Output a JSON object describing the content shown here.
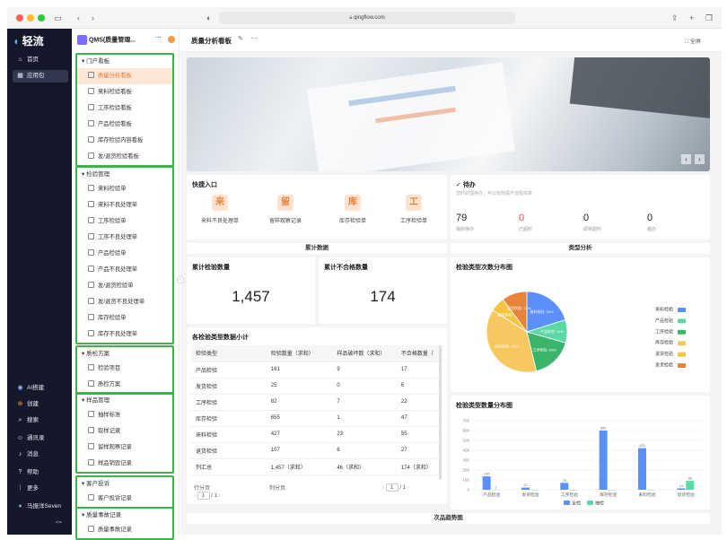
{
  "browser": {
    "url": "qingflow.com"
  },
  "rail": {
    "logo_text": "轻流",
    "items": [
      "首页",
      "应用包"
    ],
    "bottom_items": [
      "AI搭建",
      "创建",
      "搜索",
      "通讯录",
      "消息",
      "帮助",
      "更多"
    ],
    "user": "马振洋Seven",
    "collapse": "<="
  },
  "app": {
    "name": "QMS(质量管理...",
    "more": "···"
  },
  "groups": [
    {
      "name": "门户看板",
      "items": [
        "质量分析看板",
        "来料检验看板",
        "工序检验看板",
        "产品检验看板",
        "库存检验内容看板",
        "发/退货检验看板"
      ]
    },
    {
      "name": "检验管理",
      "items": [
        "来料检验单",
        "来料不良处理单",
        "工序检验单",
        "工序不良处理单",
        "产品检验单",
        "产品不良处理单",
        "发/退货检验单",
        "发/退货不良处理单",
        "库存检验单",
        "库存不良处理单"
      ]
    },
    {
      "name": "质检方案",
      "items": [
        "检验项目",
        "质检方案"
      ]
    },
    {
      "name": "样品管理",
      "items": [
        "抽样标准",
        "取样记录",
        "留样观察记录",
        "样品销毁记录"
      ]
    },
    {
      "name": "客户投诉",
      "items": [
        "客户投诉记录"
      ]
    },
    {
      "name": "质量事故记录",
      "items": [
        "质量事故记录"
      ]
    }
  ],
  "header": {
    "title": "质量分析看板",
    "fullscreen": "全屏"
  },
  "quick": {
    "title": "快捷入口",
    "items": [
      {
        "glyph": "来",
        "label": "来料不良处理单"
      },
      {
        "glyph": "留",
        "label": "留样观察记录"
      },
      {
        "glyph": "库",
        "label": "库存检验单"
      },
      {
        "glyph": "工",
        "label": "工序检验单"
      }
    ]
  },
  "todo": {
    "title": "待办",
    "subtitle": "您时处理待办，可以有效提升流程效率",
    "stats": [
      {
        "value": "79",
        "label": "我的待办"
      },
      {
        "value": "0",
        "label": "已超时"
      },
      {
        "value": "0",
        "label": "即将超时"
      },
      {
        "value": "0",
        "label": "催办"
      }
    ]
  },
  "sections": {
    "cumulative": "累计数据",
    "type_analysis": "类型分析",
    "trend": "次品趋势图"
  },
  "kpi": [
    {
      "label": "累计检验数量",
      "value": "1,457"
    },
    {
      "label": "累计不合格数量",
      "value": "174"
    }
  ],
  "table": {
    "title": "各检验类型数据小计",
    "columns": [
      "检验类型",
      "检验数量（求和）",
      "样品破坏数（求和）",
      "不合格数量（"
    ],
    "rows": [
      [
        "产品检验",
        "161",
        "9",
        "17"
      ],
      [
        "发货检验",
        "25",
        "0",
        "6"
      ],
      [
        "工序检验",
        "82",
        "7",
        "22"
      ],
      [
        "库存检验",
        "655",
        "1",
        "47"
      ],
      [
        "来料检验",
        "427",
        "23",
        "55"
      ],
      [
        "退货检验",
        "107",
        "6",
        "27"
      ]
    ],
    "summary": [
      "列汇总",
      "1,457（求和）",
      "46（求和）",
      "174（求和）"
    ],
    "pager_left": "行分页",
    "pager_right": "列分页",
    "page": "1",
    "total": "/ 1"
  },
  "pie": {
    "title": "检验类型次数分布图",
    "colors": [
      "#5b8ff9",
      "#5ad8a6",
      "#3bb56b",
      "#f6c85f",
      "#f4c542",
      "#e8833a"
    ],
    "legend": [
      "来料检验",
      "产品检验",
      "工序检验",
      "库存检验",
      "退货检验",
      "发货检验"
    ],
    "slice_labels": [
      "来料检验: 24%",
      "产品检验: 11%",
      "工序检验: 20%",
      "库存检验: 45%",
      "退货检验: 7%",
      "发货检验: 12%"
    ]
  },
  "chart_data": {
    "type": "bar",
    "title": "检验类型数量分布图",
    "categories": [
      "产品检验",
      "发货检验",
      "工序检验",
      "库存检验",
      "来料检验",
      "退货检验"
    ],
    "series": [
      {
        "name": "全检",
        "values": [
          136,
          22,
          70,
          600,
          422,
          14
        ]
      },
      {
        "name": "抽检",
        "values": [
          1,
          0,
          0,
          0,
          0,
          90
        ]
      }
    ],
    "data_labels": [
      [
        "136",
        "1"
      ],
      [
        "22",
        ""
      ],
      [
        "70",
        ""
      ],
      [
        "600",
        ""
      ],
      [
        "422",
        ""
      ],
      [
        "14",
        "90"
      ]
    ],
    "ylim": [
      0,
      700
    ],
    "yticks": [
      "0",
      "100",
      "200",
      "300",
      "400",
      "500",
      "600",
      "700"
    ],
    "colors": [
      "#5b8ff9",
      "#5ad8a6"
    ]
  }
}
